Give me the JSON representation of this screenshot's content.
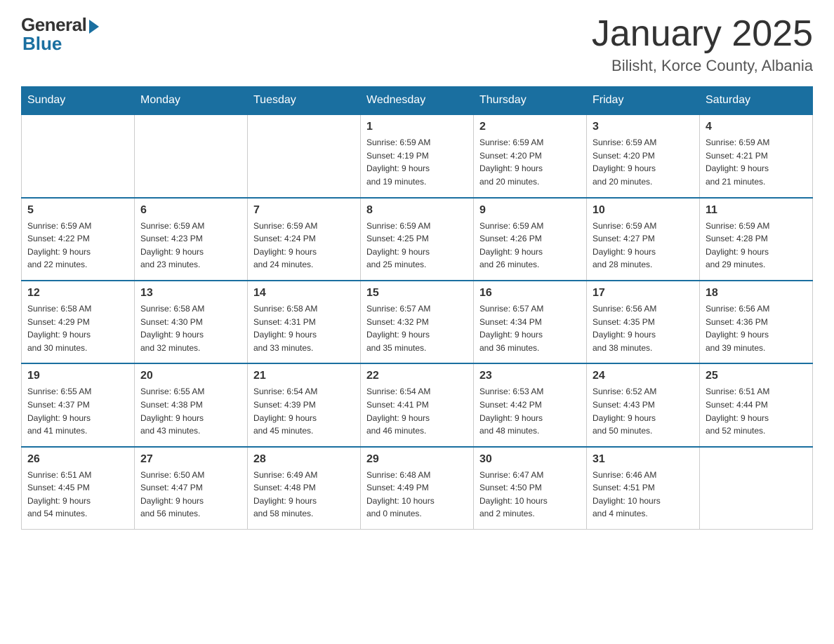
{
  "logo": {
    "general": "General",
    "blue": "Blue"
  },
  "title": "January 2025",
  "subtitle": "Bilisht, Korce County, Albania",
  "weekdays": [
    "Sunday",
    "Monday",
    "Tuesday",
    "Wednesday",
    "Thursday",
    "Friday",
    "Saturday"
  ],
  "weeks": [
    [
      {
        "day": "",
        "info": ""
      },
      {
        "day": "",
        "info": ""
      },
      {
        "day": "",
        "info": ""
      },
      {
        "day": "1",
        "info": "Sunrise: 6:59 AM\nSunset: 4:19 PM\nDaylight: 9 hours\nand 19 minutes."
      },
      {
        "day": "2",
        "info": "Sunrise: 6:59 AM\nSunset: 4:20 PM\nDaylight: 9 hours\nand 20 minutes."
      },
      {
        "day": "3",
        "info": "Sunrise: 6:59 AM\nSunset: 4:20 PM\nDaylight: 9 hours\nand 20 minutes."
      },
      {
        "day": "4",
        "info": "Sunrise: 6:59 AM\nSunset: 4:21 PM\nDaylight: 9 hours\nand 21 minutes."
      }
    ],
    [
      {
        "day": "5",
        "info": "Sunrise: 6:59 AM\nSunset: 4:22 PM\nDaylight: 9 hours\nand 22 minutes."
      },
      {
        "day": "6",
        "info": "Sunrise: 6:59 AM\nSunset: 4:23 PM\nDaylight: 9 hours\nand 23 minutes."
      },
      {
        "day": "7",
        "info": "Sunrise: 6:59 AM\nSunset: 4:24 PM\nDaylight: 9 hours\nand 24 minutes."
      },
      {
        "day": "8",
        "info": "Sunrise: 6:59 AM\nSunset: 4:25 PM\nDaylight: 9 hours\nand 25 minutes."
      },
      {
        "day": "9",
        "info": "Sunrise: 6:59 AM\nSunset: 4:26 PM\nDaylight: 9 hours\nand 26 minutes."
      },
      {
        "day": "10",
        "info": "Sunrise: 6:59 AM\nSunset: 4:27 PM\nDaylight: 9 hours\nand 28 minutes."
      },
      {
        "day": "11",
        "info": "Sunrise: 6:59 AM\nSunset: 4:28 PM\nDaylight: 9 hours\nand 29 minutes."
      }
    ],
    [
      {
        "day": "12",
        "info": "Sunrise: 6:58 AM\nSunset: 4:29 PM\nDaylight: 9 hours\nand 30 minutes."
      },
      {
        "day": "13",
        "info": "Sunrise: 6:58 AM\nSunset: 4:30 PM\nDaylight: 9 hours\nand 32 minutes."
      },
      {
        "day": "14",
        "info": "Sunrise: 6:58 AM\nSunset: 4:31 PM\nDaylight: 9 hours\nand 33 minutes."
      },
      {
        "day": "15",
        "info": "Sunrise: 6:57 AM\nSunset: 4:32 PM\nDaylight: 9 hours\nand 35 minutes."
      },
      {
        "day": "16",
        "info": "Sunrise: 6:57 AM\nSunset: 4:34 PM\nDaylight: 9 hours\nand 36 minutes."
      },
      {
        "day": "17",
        "info": "Sunrise: 6:56 AM\nSunset: 4:35 PM\nDaylight: 9 hours\nand 38 minutes."
      },
      {
        "day": "18",
        "info": "Sunrise: 6:56 AM\nSunset: 4:36 PM\nDaylight: 9 hours\nand 39 minutes."
      }
    ],
    [
      {
        "day": "19",
        "info": "Sunrise: 6:55 AM\nSunset: 4:37 PM\nDaylight: 9 hours\nand 41 minutes."
      },
      {
        "day": "20",
        "info": "Sunrise: 6:55 AM\nSunset: 4:38 PM\nDaylight: 9 hours\nand 43 minutes."
      },
      {
        "day": "21",
        "info": "Sunrise: 6:54 AM\nSunset: 4:39 PM\nDaylight: 9 hours\nand 45 minutes."
      },
      {
        "day": "22",
        "info": "Sunrise: 6:54 AM\nSunset: 4:41 PM\nDaylight: 9 hours\nand 46 minutes."
      },
      {
        "day": "23",
        "info": "Sunrise: 6:53 AM\nSunset: 4:42 PM\nDaylight: 9 hours\nand 48 minutes."
      },
      {
        "day": "24",
        "info": "Sunrise: 6:52 AM\nSunset: 4:43 PM\nDaylight: 9 hours\nand 50 minutes."
      },
      {
        "day": "25",
        "info": "Sunrise: 6:51 AM\nSunset: 4:44 PM\nDaylight: 9 hours\nand 52 minutes."
      }
    ],
    [
      {
        "day": "26",
        "info": "Sunrise: 6:51 AM\nSunset: 4:45 PM\nDaylight: 9 hours\nand 54 minutes."
      },
      {
        "day": "27",
        "info": "Sunrise: 6:50 AM\nSunset: 4:47 PM\nDaylight: 9 hours\nand 56 minutes."
      },
      {
        "day": "28",
        "info": "Sunrise: 6:49 AM\nSunset: 4:48 PM\nDaylight: 9 hours\nand 58 minutes."
      },
      {
        "day": "29",
        "info": "Sunrise: 6:48 AM\nSunset: 4:49 PM\nDaylight: 10 hours\nand 0 minutes."
      },
      {
        "day": "30",
        "info": "Sunrise: 6:47 AM\nSunset: 4:50 PM\nDaylight: 10 hours\nand 2 minutes."
      },
      {
        "day": "31",
        "info": "Sunrise: 6:46 AM\nSunset: 4:51 PM\nDaylight: 10 hours\nand 4 minutes."
      },
      {
        "day": "",
        "info": ""
      }
    ]
  ]
}
